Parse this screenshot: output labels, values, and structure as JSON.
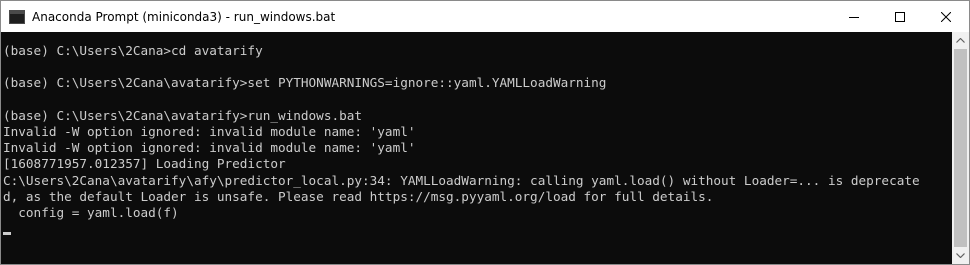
{
  "window": {
    "title": "Anaconda Prompt (miniconda3) - run_windows.bat",
    "icon": "console-icon",
    "controls": {
      "minimize_icon": "minimize-icon",
      "maximize_icon": "maximize-icon",
      "close_icon": "close-icon"
    }
  },
  "console": {
    "background": "#0c0c0c",
    "foreground": "#cccccc",
    "lines": [
      "(base) C:\\Users\\2Cana>cd avatarify",
      "",
      "(base) C:\\Users\\2Cana\\avatarify>set PYTHONWARNINGS=ignore::yaml.YAMLLoadWarning",
      "",
      "(base) C:\\Users\\2Cana\\avatarify>run_windows.bat",
      "Invalid -W option ignored: invalid module name: 'yaml'",
      "Invalid -W option ignored: invalid module name: 'yaml'",
      "[1608771957.012357] Loading Predictor",
      "C:\\Users\\2Cana\\avatarify\\afy\\predictor_local.py:34: YAMLLoadWarning: calling yaml.load() without Loader=... is deprecate",
      "d, as the default Loader is unsafe. Please read https://msg.pyyaml.org/load for full details.",
      "  config = yaml.load(f)"
    ]
  }
}
